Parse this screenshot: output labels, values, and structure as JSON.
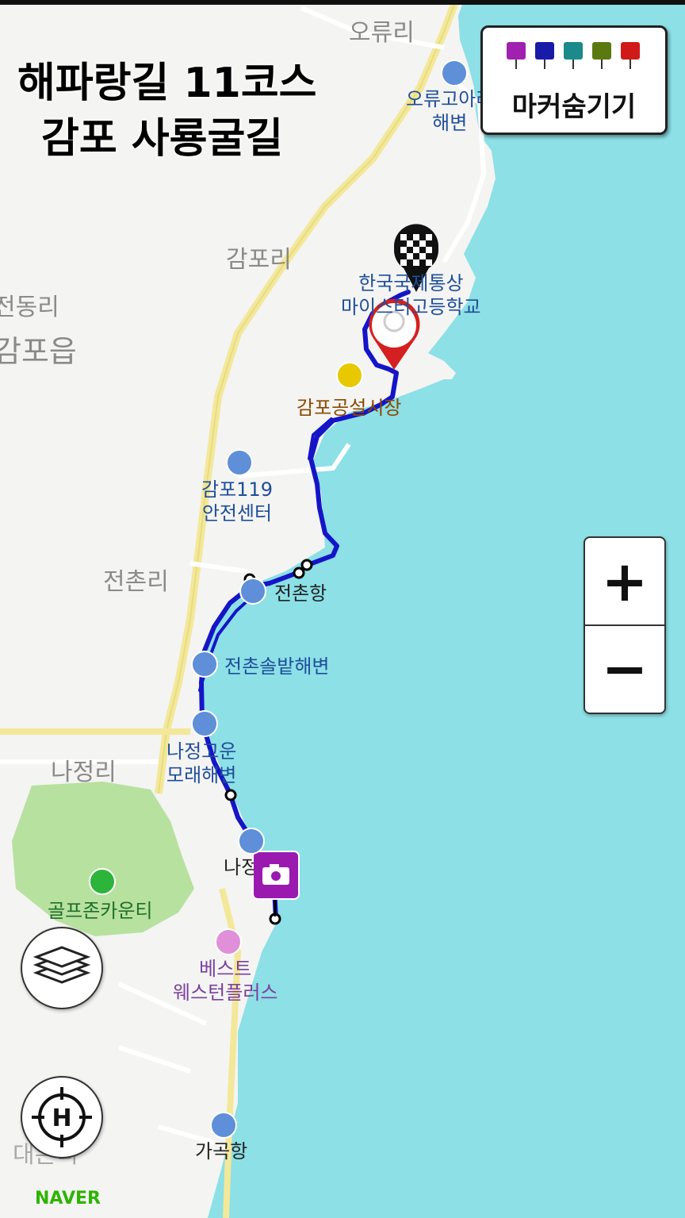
{
  "title": {
    "line1": "해파랑길 11코스",
    "line2": "감포 사룡굴길"
  },
  "marker_panel": {
    "label": "마커숨기기",
    "colors": [
      "#a020b0",
      "#1a1aa8",
      "#1a8a8a",
      "#5a7a10",
      "#d01a1a"
    ],
    "icons": [
      "camera-icon",
      "video-icon",
      "microphone-icon",
      "note-icon",
      "flag-icon"
    ]
  },
  "zoom": {
    "in": "+",
    "out": "−"
  },
  "buttons": {
    "layers_icon": "layers-icon",
    "home_icon": "crosshair-home-icon"
  },
  "villages": [
    "오류리",
    "감포리",
    "전동리",
    "감포읍",
    "전촌리",
    "나정리",
    "대본리"
  ],
  "pois": {
    "oryu_beach": "오류고아라\n해변",
    "school": "한국국제통상\n마이스터고등학교",
    "market": "감포공설시장",
    "fire_station": "감포119\n안전센터",
    "jeonchon_port": "전촌항",
    "jeonchon_beach": "전촌솔밭해변",
    "najeong_beach": "나정고운\n모래해변",
    "najeong_port": "나정항",
    "golf": "골프존카운티",
    "hotel": "베스트\n웨스턴플러스",
    "gagok_port": "가곡항"
  },
  "attribution": "NAVER",
  "colors": {
    "sea": "#8ce0e6",
    "land": "#f4f4f2",
    "route": "#1515c8",
    "road": "#f3e89a",
    "park": "#a8dc8a"
  }
}
